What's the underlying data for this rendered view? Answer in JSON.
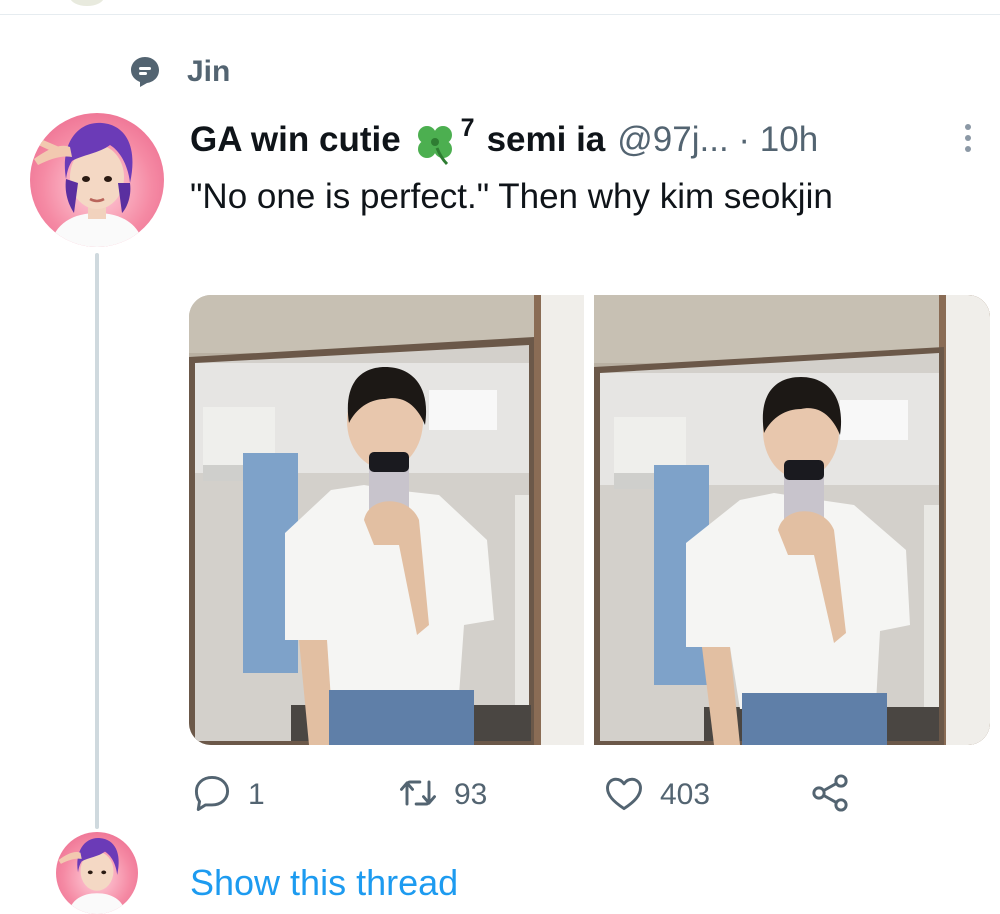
{
  "social_context": {
    "label": "Jin",
    "icon": "topic-bubble-icon"
  },
  "tweet": {
    "display_name": "GA win cutie",
    "emoji": "four-leaf-clover-icon",
    "superscript": "7",
    "display_name_rest": "semi ia",
    "handle_and_time": "@97j... · 10h",
    "text": "\"No one is perfect.\" Then why kim seokjin",
    "media_count": "2",
    "actions": {
      "reply_count": "1",
      "retweet_count": "93",
      "like_count": "403"
    }
  },
  "thread": {
    "show_thread_label": "Show this thread"
  },
  "colors": {
    "text_primary": "#0f1419",
    "text_secondary": "#536471",
    "link": "#1d9bf0",
    "divider": "#e6ecf0",
    "clover": "#4caf50"
  }
}
